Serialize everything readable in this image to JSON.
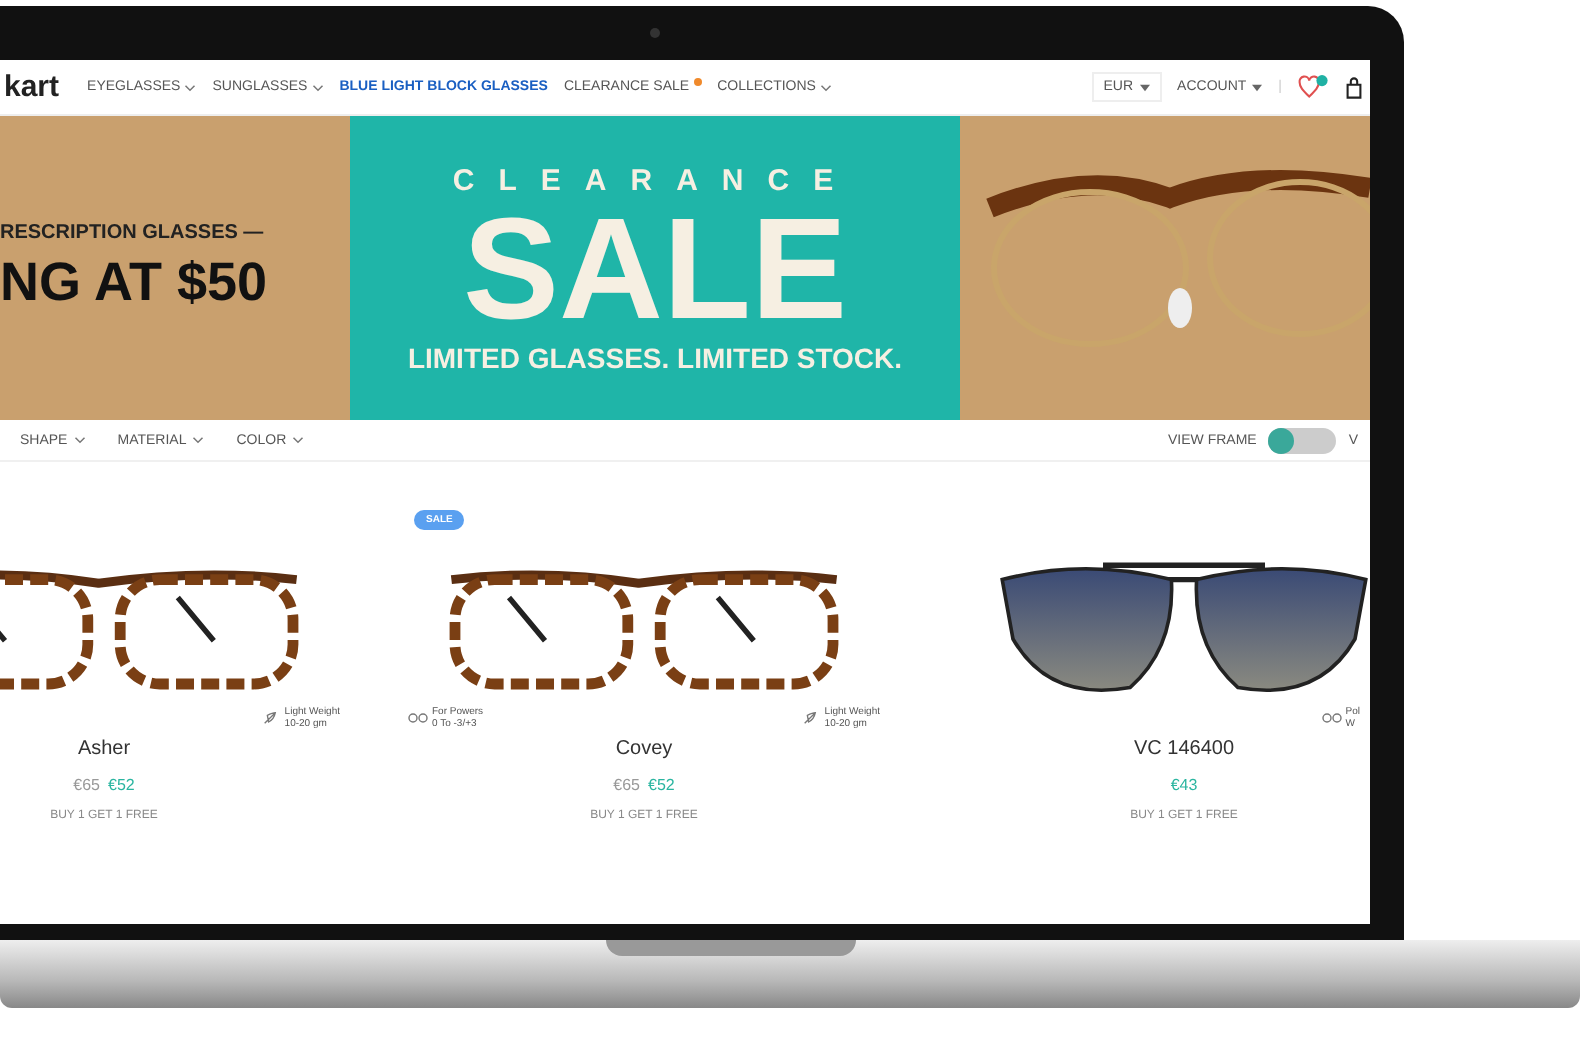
{
  "header": {
    "logo": "kart",
    "nav": [
      {
        "label": "EYEGLASSES",
        "dropdown": true,
        "highlighted": false,
        "dot": false
      },
      {
        "label": "SUNGLASSES",
        "dropdown": true,
        "highlighted": false,
        "dot": false
      },
      {
        "label": "BLUE LIGHT BLOCK GLASSES",
        "dropdown": false,
        "highlighted": true,
        "dot": false
      },
      {
        "label": "CLEARANCE SALE",
        "dropdown": false,
        "highlighted": false,
        "dot": true
      },
      {
        "label": "COLLECTIONS",
        "dropdown": true,
        "highlighted": false,
        "dot": false
      }
    ],
    "currency": "EUR",
    "account": "ACCOUNT",
    "separator": "|"
  },
  "banner": {
    "left_line1": "RESCRIPTION GLASSES —",
    "left_line2": "NG AT $50",
    "kicker": "CLEARANCE",
    "headline": "SALE",
    "tagline": "LIMITED GLASSES. LIMITED STOCK."
  },
  "filters": [
    {
      "label": "SHAPE"
    },
    {
      "label": "MATERIAL"
    },
    {
      "label": "COLOR"
    }
  ],
  "view_toggle": {
    "label": "VIEW FRAME",
    "on": false,
    "cut_label": "V"
  },
  "products": [
    {
      "kind": "eyeglasses",
      "name": "Asher",
      "old_price": "€65",
      "price": "€52",
      "promo": "BUY 1 GET 1 FREE",
      "feature_right": {
        "kind": "weight",
        "line1": "Light Weight",
        "line2": "10-20 gm"
      }
    },
    {
      "kind": "eyeglasses",
      "badge": "SALE",
      "name": "Covey",
      "old_price": "€65",
      "price": "€52",
      "promo": "BUY 1 GET 1 FREE",
      "feature_left": {
        "kind": "powers",
        "line1": "For Powers",
        "line2": "0 To -3/+3"
      },
      "feature_right": {
        "kind": "weight",
        "line1": "Light Weight",
        "line2": "10-20 gm"
      }
    },
    {
      "kind": "sunglasses",
      "name": "VC 146400",
      "price": "€43",
      "promo": "BUY 1 GET 1 FREE",
      "feature_right": {
        "kind": "powers",
        "line1": "Pol",
        "line2": "W"
      }
    }
  ]
}
